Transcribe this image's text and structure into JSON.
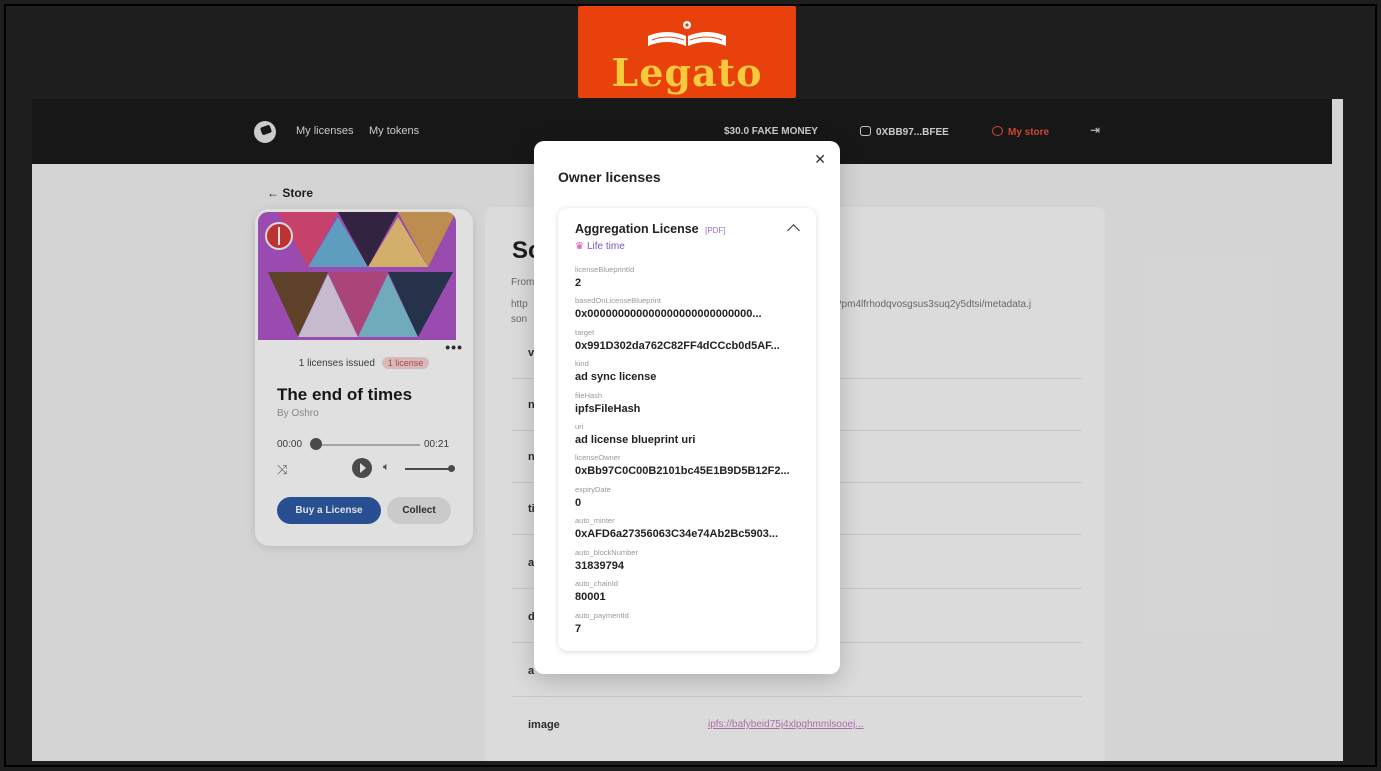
{
  "banner": {
    "logo_text": "Legato"
  },
  "nav": {
    "my_licenses": "My licenses",
    "my_tokens": "My tokens",
    "money": "$30.0 FAKE MONEY",
    "wallet": "0XBB97...BFEE",
    "my_store": "My store"
  },
  "page": {
    "back_label": "Store",
    "title_partial": "Sc",
    "from_partial": "From",
    "uri_left": "http",
    "uri_left2": "son",
    "uri_right": "?pm4lfrhodqvosgsus3suq2y5dtsi/metadata.j",
    "rows": [
      {
        "label": "v",
        "value": ""
      },
      {
        "label": "n",
        "value": ""
      },
      {
        "label": "n",
        "value": ""
      },
      {
        "label": "ti",
        "value": ""
      },
      {
        "label": "a",
        "value": ""
      },
      {
        "label": "d",
        "value": ""
      },
      {
        "label": "a",
        "value": ""
      },
      {
        "label": "image",
        "value": "ipfs://bafybeid75j4xlpghmmlsooej..."
      }
    ]
  },
  "player": {
    "issued_text": "1 licenses issued",
    "license_pill": "1 license",
    "title": "The end of times",
    "artist": "By Oshro",
    "time_start": "00:00",
    "time_end": "00:21",
    "progress": 0.0,
    "buy_label": "Buy a License",
    "collect_label": "Collect"
  },
  "modal": {
    "title": "Owner licenses",
    "license": {
      "name": "Aggregation License",
      "pdf_tag": "[PDF]",
      "duration": "Life time",
      "fields": [
        {
          "key": "licenseBlueprintId",
          "value": "2"
        },
        {
          "key": "basedOnLicenseBlueprint",
          "value": "0x000000000000000000000000000..."
        },
        {
          "key": "target",
          "value": "0x991D302da762C82FF4dCCcb0d5AF..."
        },
        {
          "key": "kind",
          "value": "ad sync license"
        },
        {
          "key": "fileHash",
          "value": "ipfsFileHash"
        },
        {
          "key": "uri",
          "value": "ad license blueprint uri"
        },
        {
          "key": "licenseOwner",
          "value": "0xBb97C0C00B2101bc45E1B9D5B12F2..."
        },
        {
          "key": "expiryDate",
          "value": "0"
        },
        {
          "key": "auto_minter",
          "value": "0xAFD6a27356063C34e74Ab2Bc5903..."
        },
        {
          "key": "auto_blockNumber",
          "value": "31839794"
        },
        {
          "key": "auto_chainId",
          "value": "80001"
        },
        {
          "key": "auto_paymentId",
          "value": "7"
        }
      ]
    }
  }
}
